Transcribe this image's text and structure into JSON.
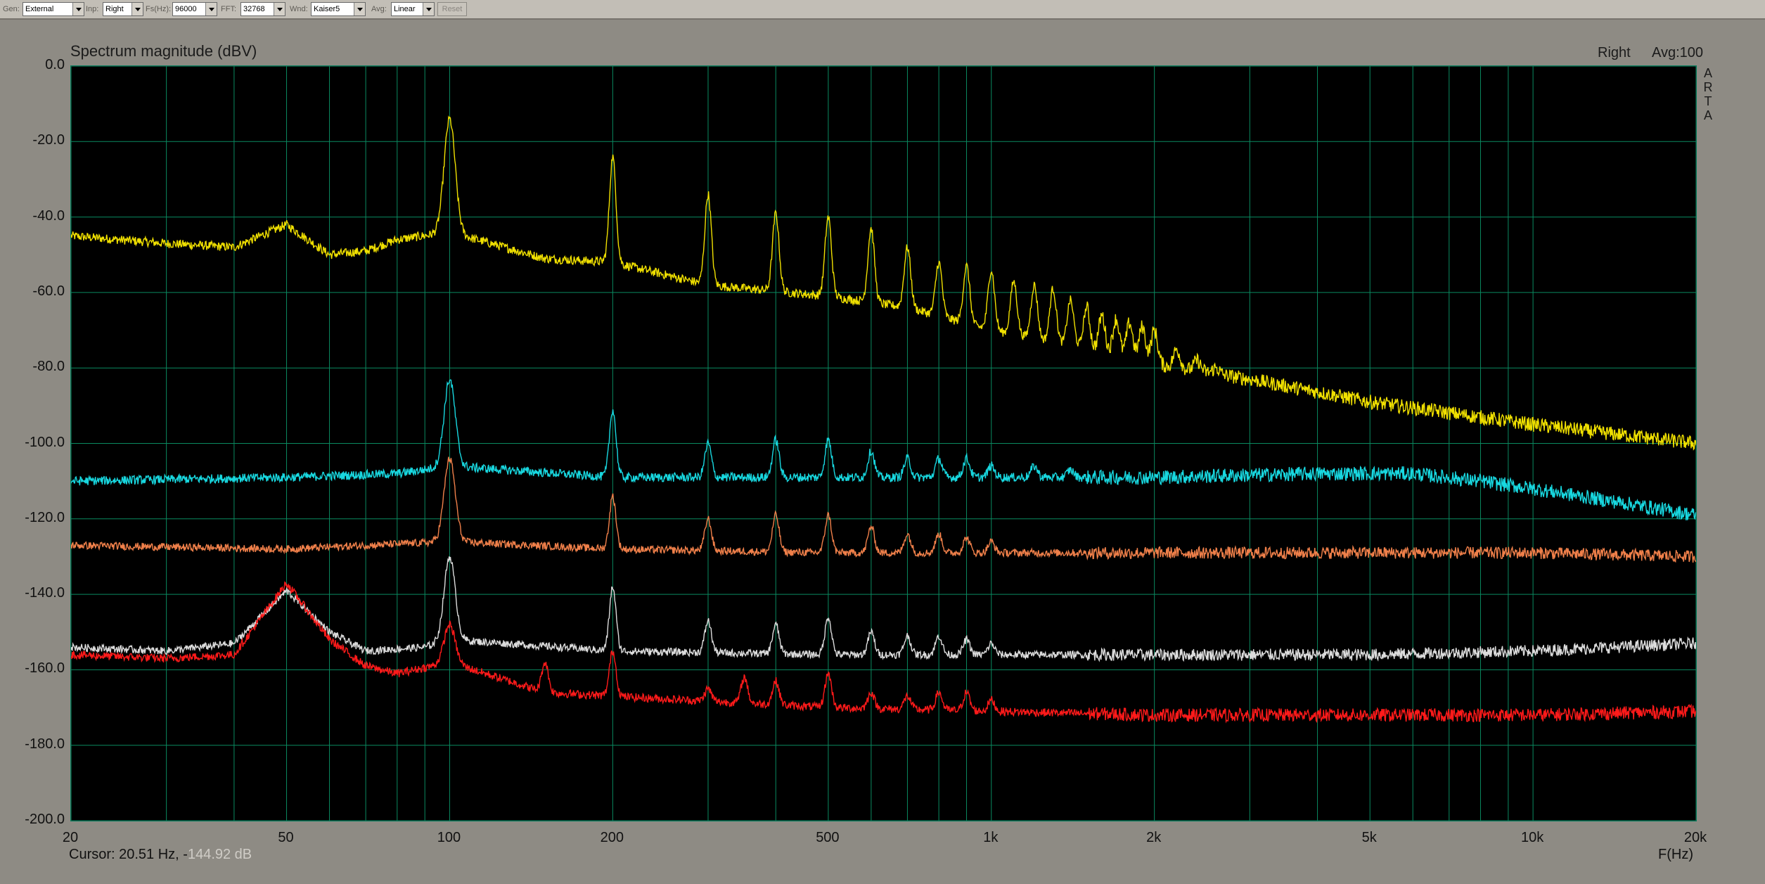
{
  "toolbar": {
    "gen": {
      "label": "Gen:",
      "value": "External"
    },
    "inp": {
      "label": "Inp:",
      "value": "Right"
    },
    "fs": {
      "label": "Fs(Hz):",
      "value": "96000"
    },
    "fft": {
      "label": "FFT:",
      "value": "32768"
    },
    "wnd": {
      "label": "Wnd:",
      "value": "Kaiser5"
    },
    "avg": {
      "label": "Avg:",
      "value": "Linear"
    },
    "reset_label": "Reset"
  },
  "header": {
    "title": "Spectrum magnitude (dBV)",
    "channel": "Right",
    "avg": "Avg:100",
    "logo": [
      "A",
      "R",
      "T",
      "A"
    ]
  },
  "footer": {
    "cursor_text": "Cursor: 20.51 Hz, -",
    "cursor_value": "144.92 dB",
    "xlabel": "F(Hz)"
  },
  "colors": {
    "grid": "#0a8a60",
    "background": "#000000",
    "panel": "#8e8b84"
  },
  "chart_data": {
    "type": "line",
    "title": "Spectrum magnitude (dBV)",
    "xlabel": "F(Hz)",
    "ylabel": "",
    "xscale": "log",
    "xlim": [
      20,
      20000
    ],
    "ylim": [
      -200,
      0
    ],
    "grid": true,
    "y_tick_labels": [
      "0.0",
      "-20.0",
      "-40.0",
      "-60.0",
      "-80.0",
      "-100.0",
      "-120.0",
      "-140.0",
      "-160.0",
      "-180.0",
      "-200.0"
    ],
    "y_ticks": [
      0,
      -20,
      -40,
      -60,
      -80,
      -100,
      -120,
      -140,
      -160,
      -180,
      -200
    ],
    "x_tick_labels": [
      "20",
      "50",
      "100",
      "200",
      "500",
      "1k",
      "2k",
      "5k",
      "10k",
      "20k"
    ],
    "x_ticks": [
      20,
      50,
      100,
      200,
      500,
      1000,
      2000,
      5000,
      10000,
      20000
    ],
    "x_minor_grid": [
      30,
      40,
      60,
      70,
      80,
      90,
      300,
      400,
      600,
      700,
      800,
      900,
      3000,
      4000,
      6000,
      7000,
      8000,
      9000
    ],
    "series": [
      {
        "color": "#f0e000",
        "base": [
          [
            20,
            -45
          ],
          [
            30,
            -47
          ],
          [
            40,
            -48
          ],
          [
            50,
            -42
          ],
          [
            60,
            -50
          ],
          [
            70,
            -49
          ],
          [
            80,
            -46
          ],
          [
            100,
            -44
          ],
          [
            150,
            -51
          ],
          [
            200,
            -52
          ],
          [
            300,
            -58
          ],
          [
            500,
            -61
          ],
          [
            700,
            -64
          ],
          [
            1000,
            -70
          ],
          [
            1500,
            -75
          ],
          [
            2000,
            -79
          ],
          [
            3000,
            -83
          ],
          [
            5000,
            -89
          ],
          [
            10000,
            -95
          ],
          [
            20000,
            -100
          ]
        ],
        "peaks": [
          [
            100,
            -14
          ],
          [
            200,
            -24
          ],
          [
            300,
            -34
          ],
          [
            400,
            -39
          ],
          [
            500,
            -40
          ],
          [
            600,
            -43
          ],
          [
            700,
            -48
          ],
          [
            800,
            -52
          ],
          [
            900,
            -53
          ],
          [
            1000,
            -54
          ],
          [
            1100,
            -57
          ],
          [
            1200,
            -58
          ],
          [
            1300,
            -59
          ],
          [
            1400,
            -62
          ],
          [
            1500,
            -64
          ],
          [
            1600,
            -66
          ],
          [
            1700,
            -67
          ],
          [
            1800,
            -68
          ],
          [
            1900,
            -69
          ],
          [
            2000,
            -70
          ],
          [
            2200,
            -75
          ],
          [
            2400,
            -78
          ],
          [
            2600,
            -80
          ]
        ],
        "noise": 1.2
      },
      {
        "color": "#18d8e0",
        "base": [
          [
            20,
            -110
          ],
          [
            50,
            -109
          ],
          [
            80,
            -108
          ],
          [
            100,
            -106
          ],
          [
            200,
            -109
          ],
          [
            500,
            -109
          ],
          [
            1000,
            -109
          ],
          [
            2000,
            -109
          ],
          [
            4000,
            -108
          ],
          [
            6000,
            -108
          ],
          [
            8000,
            -110
          ],
          [
            10000,
            -112
          ],
          [
            15000,
            -116
          ],
          [
            20000,
            -119
          ]
        ],
        "peaks": [
          [
            100,
            -83
          ],
          [
            200,
            -91
          ],
          [
            300,
            -100
          ],
          [
            400,
            -99
          ],
          [
            500,
            -99
          ],
          [
            600,
            -102
          ],
          [
            700,
            -104
          ],
          [
            800,
            -104
          ],
          [
            900,
            -104
          ],
          [
            1000,
            -106
          ],
          [
            1200,
            -106
          ],
          [
            1400,
            -107
          ]
        ],
        "noise": 1.2
      },
      {
        "color": "#f0804a",
        "base": [
          [
            20,
            -127
          ],
          [
            50,
            -128
          ],
          [
            100,
            -126
          ],
          [
            200,
            -128
          ],
          [
            500,
            -129
          ],
          [
            1000,
            -129
          ],
          [
            2000,
            -129
          ],
          [
            5000,
            -129
          ],
          [
            10000,
            -129
          ],
          [
            20000,
            -130
          ]
        ],
        "peaks": [
          [
            100,
            -104
          ],
          [
            200,
            -114
          ],
          [
            300,
            -120
          ],
          [
            400,
            -119
          ],
          [
            500,
            -119
          ],
          [
            600,
            -122
          ],
          [
            700,
            -124
          ],
          [
            800,
            -124
          ],
          [
            900,
            -125
          ],
          [
            1000,
            -126
          ]
        ],
        "noise": 1.0
      },
      {
        "color": "#dcdcdc",
        "base": [
          [
            20,
            -154
          ],
          [
            30,
            -155
          ],
          [
            40,
            -153
          ],
          [
            50,
            -139
          ],
          [
            60,
            -150
          ],
          [
            70,
            -155
          ],
          [
            90,
            -154
          ],
          [
            100,
            -152
          ],
          [
            200,
            -155
          ],
          [
            500,
            -156
          ],
          [
            1000,
            -156
          ],
          [
            2000,
            -156
          ],
          [
            5000,
            -156
          ],
          [
            10000,
            -155
          ],
          [
            20000,
            -153
          ]
        ],
        "peaks": [
          [
            100,
            -130
          ],
          [
            200,
            -138
          ],
          [
            300,
            -147
          ],
          [
            400,
            -148
          ],
          [
            500,
            -146
          ],
          [
            600,
            -150
          ],
          [
            700,
            -151
          ],
          [
            800,
            -151
          ],
          [
            900,
            -152
          ],
          [
            1000,
            -153
          ]
        ],
        "noise": 1.0
      },
      {
        "color": "#ff1a1a",
        "base": [
          [
            20,
            -156
          ],
          [
            30,
            -157
          ],
          [
            40,
            -156
          ],
          [
            50,
            -137
          ],
          [
            60,
            -152
          ],
          [
            70,
            -159
          ],
          [
            80,
            -161
          ],
          [
            100,
            -158
          ],
          [
            150,
            -166
          ],
          [
            200,
            -167
          ],
          [
            500,
            -170
          ],
          [
            1000,
            -171
          ],
          [
            2000,
            -172
          ],
          [
            5000,
            -172
          ],
          [
            10000,
            -172
          ],
          [
            20000,
            -171
          ]
        ],
        "peaks": [
          [
            100,
            -148
          ],
          [
            150,
            -158
          ],
          [
            200,
            -155
          ],
          [
            300,
            -165
          ],
          [
            350,
            -162
          ],
          [
            400,
            -163
          ],
          [
            500,
            -161
          ],
          [
            600,
            -166
          ],
          [
            700,
            -167
          ],
          [
            800,
            -166
          ],
          [
            900,
            -166
          ],
          [
            1000,
            -168
          ]
        ],
        "noise": 1.1
      }
    ]
  }
}
